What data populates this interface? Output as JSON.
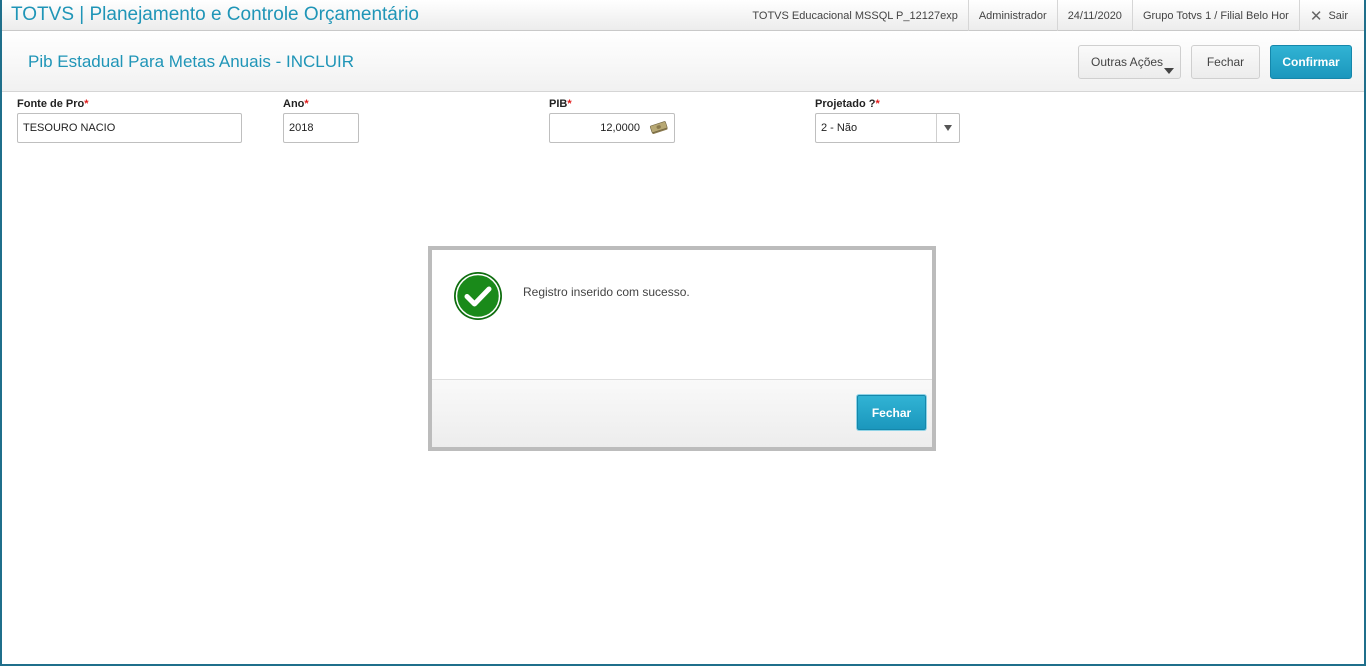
{
  "app": {
    "title": "TOTVS | Planejamento e Controle Orçamentário"
  },
  "topbar": {
    "environment": "TOTVS Educacional MSSQL P_12127exp",
    "user": "Administrador",
    "date": "24/11/2020",
    "branch": "Grupo Totvs 1 / Filial Belo Hor",
    "exit_label": "Sair"
  },
  "header": {
    "page_title": "Pib Estadual Para Metas Anuais - INCLUIR",
    "other_actions_label": "Outras Ações",
    "close_label": "Fechar",
    "confirm_label": "Confirmar"
  },
  "form": {
    "fonte": {
      "label": "Fonte de Pro",
      "required_mark": "*",
      "value": "TESOURO NACIO"
    },
    "ano": {
      "label": "Ano",
      "required_mark": "*",
      "value": "2018"
    },
    "pib": {
      "label": "PIB",
      "required_mark": "*",
      "value": "12,0000"
    },
    "projetado": {
      "label": "Projetado ?",
      "required_mark": "*",
      "value": "2 - Não"
    }
  },
  "modal": {
    "message": "Registro inserido com sucesso.",
    "close_label": "Fechar"
  },
  "colors": {
    "accent": "#1f95b7",
    "primary_button": "#1b97bd",
    "success": "#1a8a1a",
    "required": "#e21b1b"
  },
  "icons": {
    "close": "close-icon",
    "money": "money-icon",
    "dropdown": "chevron-down-icon",
    "success": "check-circle-icon"
  }
}
